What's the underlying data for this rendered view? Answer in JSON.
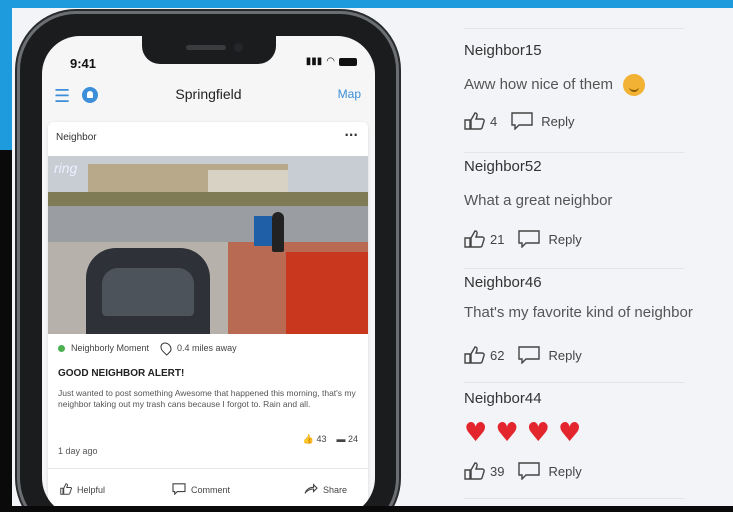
{
  "phone": {
    "status_time": "9:41",
    "app_title": "Springfield",
    "map_label": "Map",
    "card": {
      "header": "Neighbor",
      "more": "···",
      "video_logo": "ring",
      "category": "Neighborly Moment",
      "distance": "0.4 miles away",
      "title": "GOOD NEIGHBOR ALERT!",
      "body": "Just wanted to post something Awesome that happened this morning, that's my neighbor taking out my trash cans because I forgot to. Rain and all.",
      "age": "1 day ago",
      "likes": "43",
      "comments_count": "24",
      "actions": {
        "helpful": "Helpful",
        "comment": "Comment",
        "share": "Share"
      }
    }
  },
  "comments": [
    {
      "name": "Neighbor15",
      "text": "Aww how nice of them",
      "likes": "4",
      "reply": "Reply",
      "emoji": "smiling-face"
    },
    {
      "name": "Neighbor52",
      "text": "What a great neighbor",
      "likes": "21",
      "reply": "Reply"
    },
    {
      "name": "Neighbor46",
      "text": "That's my favorite kind of neighbor",
      "likes": "62",
      "reply": "Reply"
    },
    {
      "name": "Neighbor44",
      "text": "",
      "hearts": 4,
      "likes": "39",
      "reply": "Reply"
    }
  ],
  "colors": {
    "accent": "#3c8fd8",
    "heart": "#e3262e",
    "frame": "#1e9bdc"
  }
}
